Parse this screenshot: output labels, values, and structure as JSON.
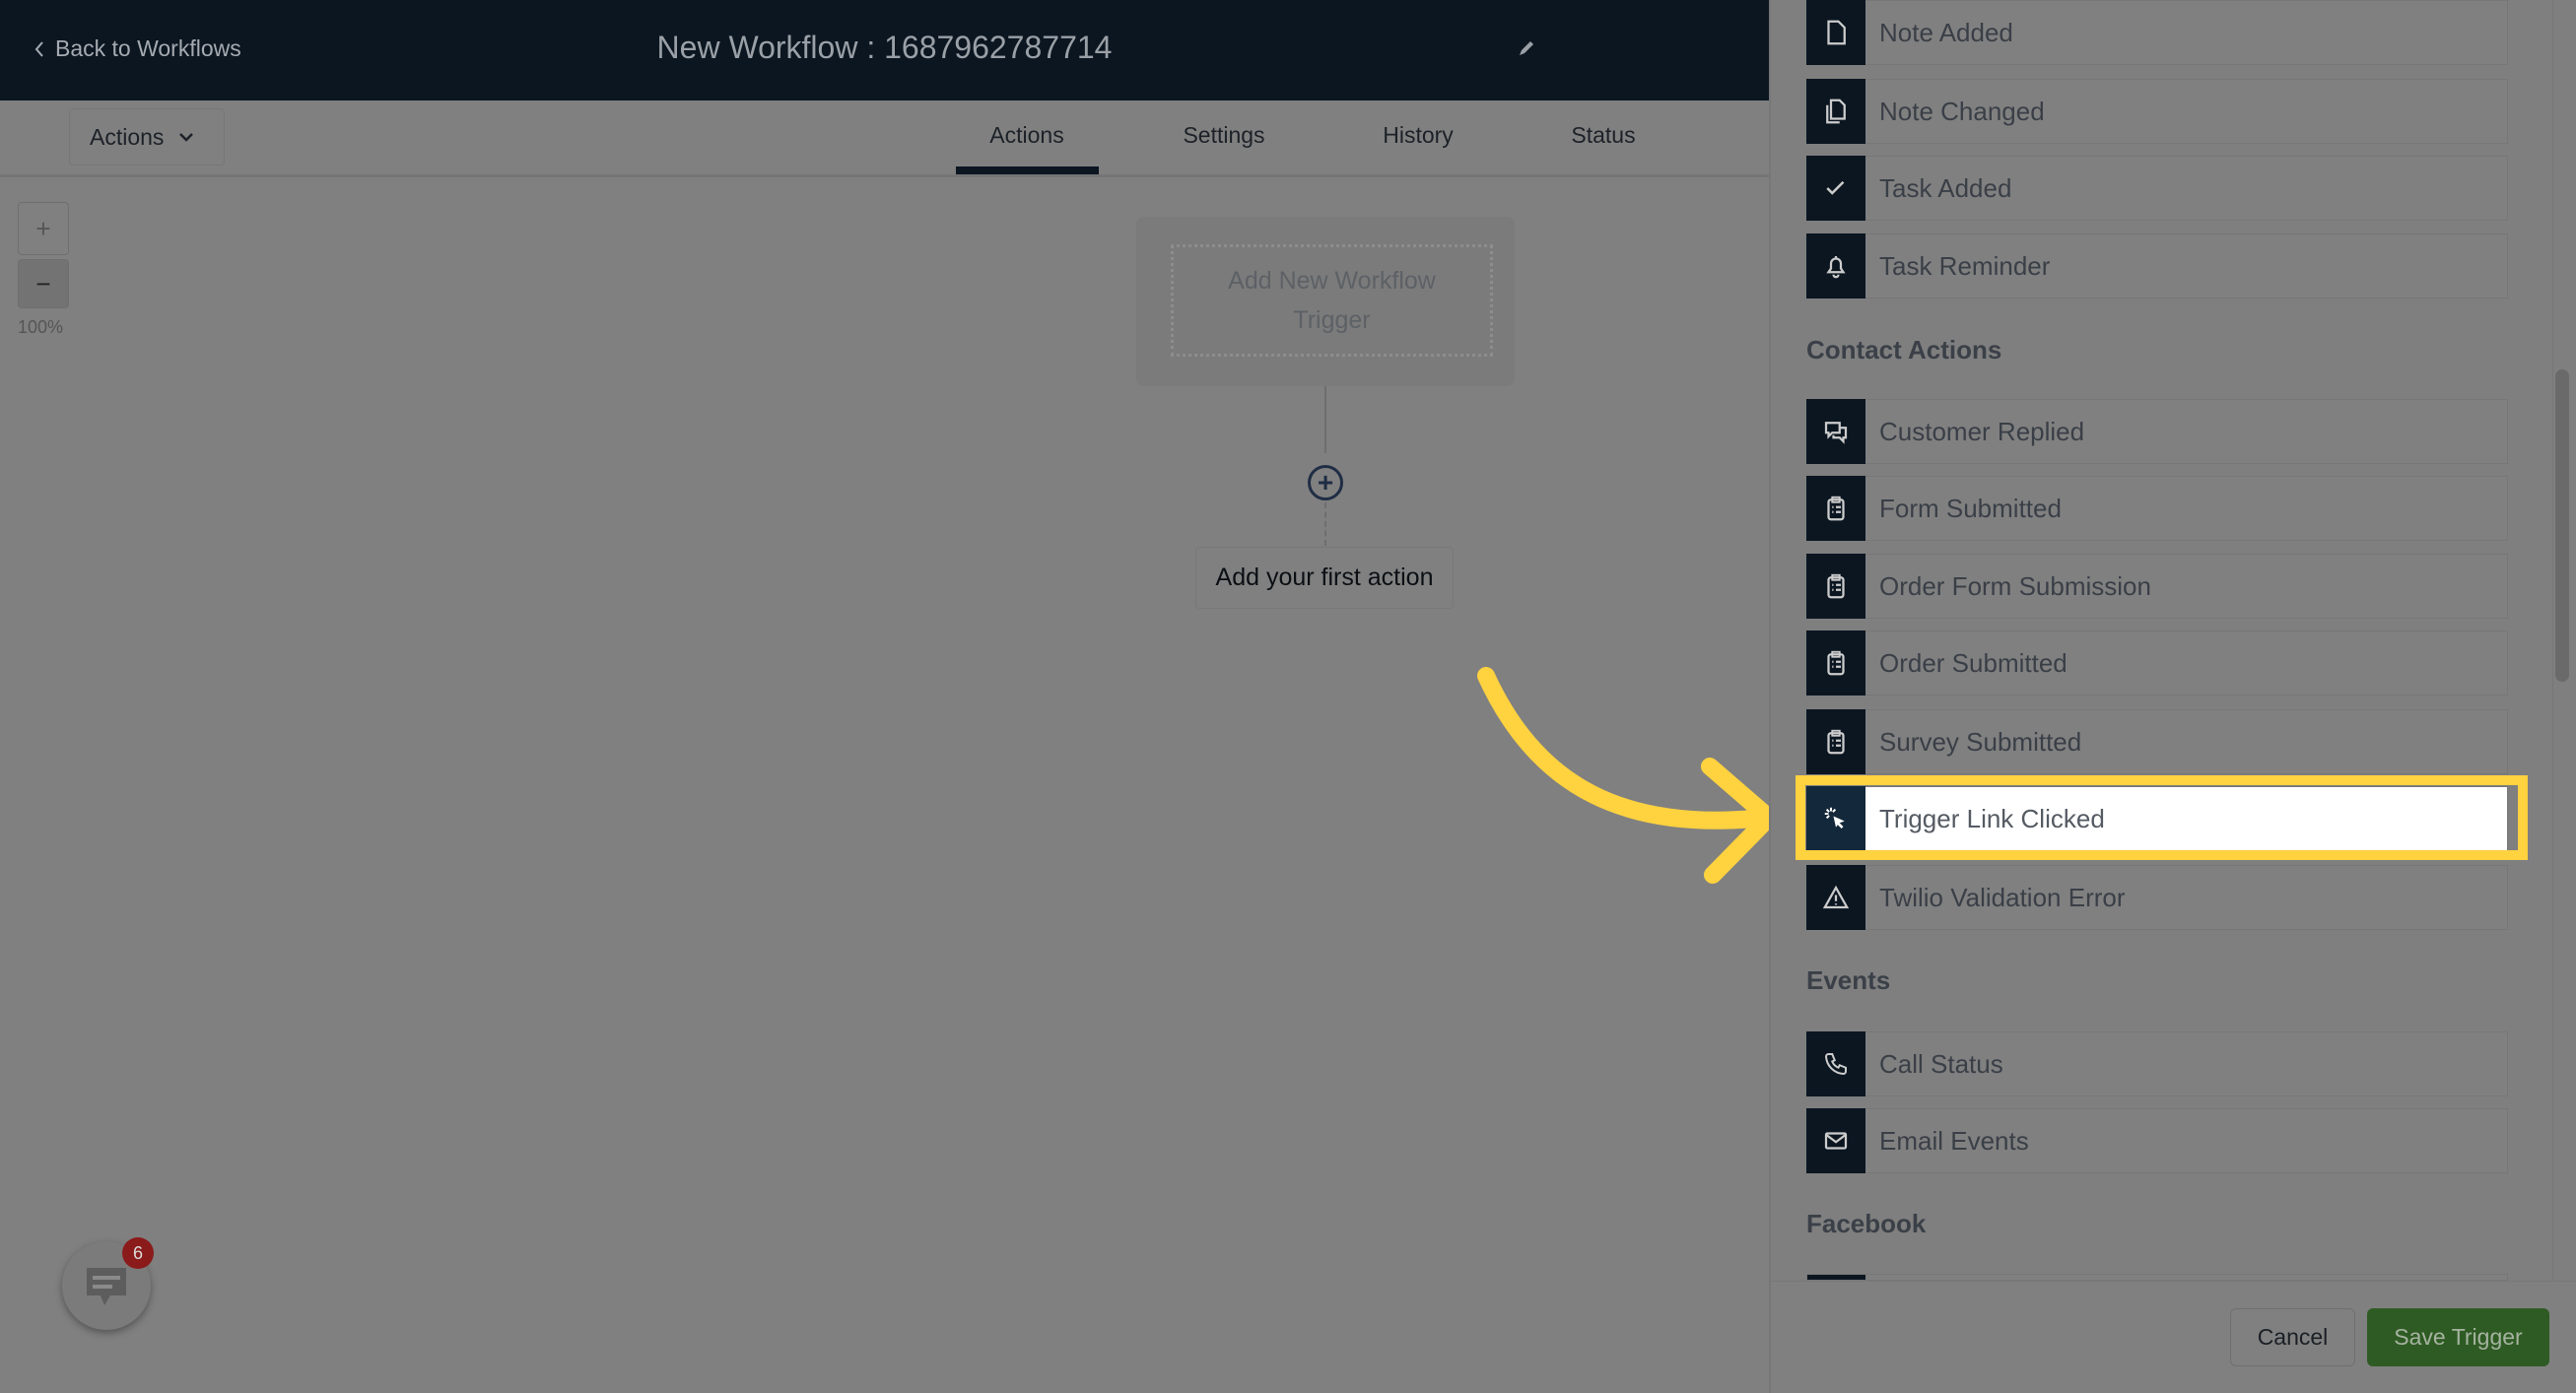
{
  "header": {
    "back_label": "Back to Workflows",
    "title": "New Workflow : 1687962787714"
  },
  "toolbar": {
    "actions_dropdown": "Actions"
  },
  "tabs": [
    {
      "label": "Actions",
      "active": true
    },
    {
      "label": "Settings"
    },
    {
      "label": "History"
    },
    {
      "label": "Status"
    }
  ],
  "zoom": {
    "plus": "+",
    "minus": "−",
    "level": "100%"
  },
  "canvas": {
    "trigger_placeholder": "Add New Workflow Trigger",
    "first_action": "Add your first action"
  },
  "panel": {
    "items_top": [
      {
        "label": "Note Added",
        "icon": "file-icon"
      },
      {
        "label": "Note Changed",
        "icon": "files-icon"
      },
      {
        "label": "Task Added",
        "icon": "check-icon"
      },
      {
        "label": "Task Reminder",
        "icon": "bell-icon"
      }
    ],
    "contact_heading": "Contact Actions",
    "contact_items": [
      {
        "label": "Customer Replied",
        "icon": "chat-bubbles-icon"
      },
      {
        "label": "Form Submitted",
        "icon": "clipboard-icon"
      },
      {
        "label": "Order Form Submission",
        "icon": "clipboard-icon"
      },
      {
        "label": "Order Submitted",
        "icon": "clipboard-icon"
      },
      {
        "label": "Survey Submitted",
        "icon": "clipboard-icon"
      },
      {
        "label": "Trigger Link Clicked",
        "icon": "cursor-click-icon",
        "selected": true
      },
      {
        "label": "Twilio Validation Error",
        "icon": "warning-icon"
      }
    ],
    "events_heading": "Events",
    "events_items": [
      {
        "label": "Call Status",
        "icon": "phone-icon"
      },
      {
        "label": "Email Events",
        "icon": "envelope-icon"
      }
    ],
    "facebook_heading": "Facebook"
  },
  "footer": {
    "cancel": "Cancel",
    "save": "Save Trigger"
  },
  "chat_widget": {
    "badge_count": "6"
  },
  "colors": {
    "highlight": "#ffd23f",
    "header": "#0b1621",
    "save": "#2e5b23"
  }
}
